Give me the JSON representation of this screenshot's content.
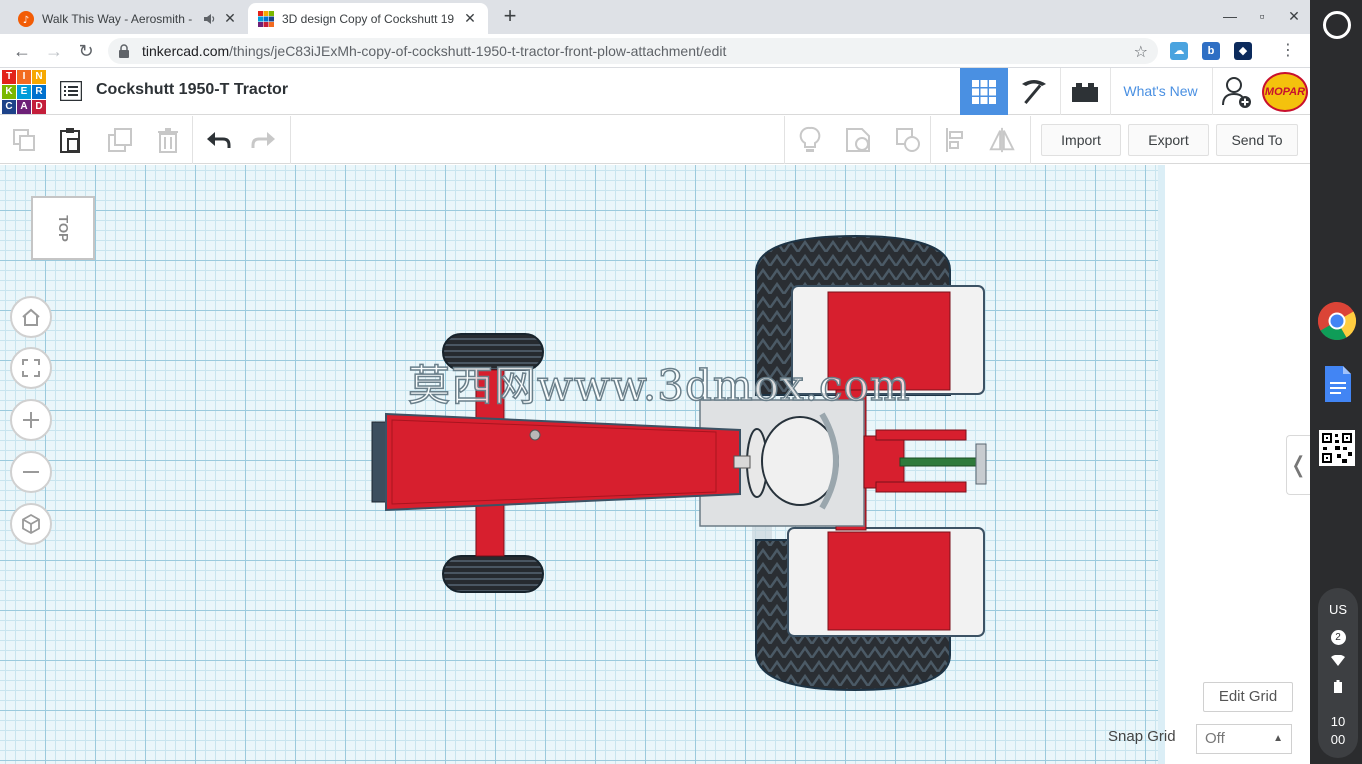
{
  "browser": {
    "tabs": [
      {
        "title": "Walk This Way - Aerosmith -",
        "active": false,
        "audio": true
      },
      {
        "title": "3D design Copy of Cockshutt 19",
        "active": true,
        "audio": false
      }
    ],
    "url_host": "tinkercad.com",
    "url_path": "/things/jeC83iJExMh-copy-of-cockshutt-1950-t-tractor-front-plow-attachment/edit"
  },
  "header": {
    "logo_letters": [
      "T",
      "I",
      "N",
      "K",
      "E",
      "R",
      "C",
      "A",
      "D"
    ],
    "logo_colors": [
      "#e2231a",
      "#f26b21",
      "#f6a800",
      "#7ab800",
      "#009dd9",
      "#0071ce",
      "#1d4289",
      "#6d2077",
      "#c41e3a"
    ],
    "design_title": "Cockshutt 1950-T Tractor",
    "whats_new": "What's New",
    "profile_badge": "MOPAR",
    "accent": "#4a90e2"
  },
  "edit_toolbar": {
    "import": "Import",
    "export": "Export",
    "send_to": "Send To"
  },
  "workplane": {
    "view_cube_label": "TOP",
    "watermark": "莫西网www.3dmox.com",
    "edit_grid": "Edit Grid",
    "snap_grid_label": "Snap Grid",
    "snap_grid_value": "Off"
  },
  "shelf": {
    "locale": "US",
    "notifications": "2",
    "time_hour": "10",
    "time_minute": "00"
  }
}
